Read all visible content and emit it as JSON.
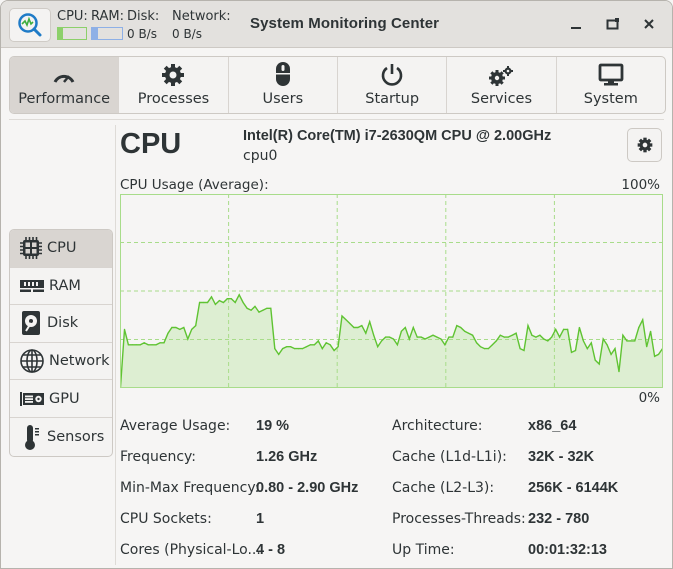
{
  "window": {
    "title": "System Monitoring Center",
    "minimize_icon": "minimize-icon",
    "maximize_icon": "restore-icon",
    "close_icon": "close-icon"
  },
  "header_mini": {
    "cpu_label": "CPU:",
    "ram_label": "RAM:",
    "disk_label": "Disk:",
    "network_label": "Network:",
    "disk_value": "0 B/s",
    "network_value": "0 B/s",
    "cpu_bar_fraction": 0.19,
    "ram_bar_fraction": 0.2,
    "cpu_color": "#8cd06a",
    "ram_color": "#8eb0e6"
  },
  "main_tabs": [
    {
      "label": "Performance",
      "icon": "speedometer-icon",
      "active": true
    },
    {
      "label": "Processes",
      "icon": "gear-icon",
      "active": false
    },
    {
      "label": "Users",
      "icon": "mouse-icon",
      "active": false
    },
    {
      "label": "Startup",
      "icon": "power-icon",
      "active": false
    },
    {
      "label": "Services",
      "icon": "gears-icon",
      "active": false
    },
    {
      "label": "System",
      "icon": "monitor-icon",
      "active": false
    }
  ],
  "side_tabs": [
    {
      "label": "CPU",
      "icon": "cpu-chip-icon",
      "active": true
    },
    {
      "label": "RAM",
      "icon": "ram-icon",
      "active": false
    },
    {
      "label": "Disk",
      "icon": "disk-icon",
      "active": false
    },
    {
      "label": "Network",
      "icon": "globe-icon",
      "active": false
    },
    {
      "label": "GPU",
      "icon": "gpu-icon",
      "active": false
    },
    {
      "label": "Sensors",
      "icon": "thermometer-icon",
      "active": false
    }
  ],
  "cpu": {
    "title": "CPU",
    "model": "Intel(R) Core(TM) i7-2630QM CPU @ 2.00GHz",
    "device": "cpu0",
    "settings_icon": "gear-icon"
  },
  "chart_data": {
    "type": "area",
    "title": "CPU Usage (Average):",
    "max_label": "100%",
    "min_label": "0%",
    "ylim": [
      0,
      100
    ],
    "grid": true,
    "line_color": "#5fc332",
    "fill_color": "#ddeed2",
    "grid_color": "#a8dc8a",
    "values": [
      0,
      30,
      22,
      22,
      22,
      22,
      23,
      22,
      22,
      22,
      23,
      23,
      28,
      31,
      31,
      30,
      31,
      25,
      30,
      32,
      44,
      44,
      44,
      47,
      43,
      45,
      44,
      46,
      46,
      44,
      48,
      44,
      41,
      40,
      42,
      39,
      40,
      41,
      41,
      20,
      17,
      20,
      21,
      21,
      20,
      20,
      20,
      21,
      22,
      22,
      24,
      20,
      23,
      22,
      19,
      21,
      37,
      35,
      33,
      31,
      31,
      32,
      28,
      34,
      27,
      21,
      24,
      26,
      26,
      25,
      22,
      29,
      31,
      25,
      31,
      26,
      26,
      25,
      26,
      27,
      26,
      25,
      22,
      26,
      26,
      32,
      31,
      29,
      28,
      27,
      23,
      21,
      20,
      20,
      22,
      24,
      27,
      26,
      26,
      27,
      28,
      20,
      19,
      32,
      27,
      26,
      27,
      25,
      24,
      26,
      30,
      26,
      30,
      30,
      18,
      19,
      31,
      24,
      20,
      23,
      14,
      12,
      25,
      22,
      17,
      20,
      8,
      27,
      24,
      24,
      24,
      31,
      35,
      21,
      29,
      16,
      17,
      20
    ]
  },
  "info_left": [
    {
      "label": "Average Usage:",
      "value": "19 %"
    },
    {
      "label": "Frequency:",
      "value": "1.26 GHz"
    },
    {
      "label": "Min-Max Frequency:",
      "value": "0.80 - 2.90 GHz"
    },
    {
      "label": "CPU Sockets:",
      "value": "1"
    },
    {
      "label": "Cores (Physical-Lo...",
      "value": "4 - 8"
    }
  ],
  "info_right": [
    {
      "label": "Architecture:",
      "value": "x86_64"
    },
    {
      "label": "Cache (L1d-L1i):",
      "value": "32K - 32K"
    },
    {
      "label": "Cache (L2-L3):",
      "value": "256K - 6144K"
    },
    {
      "label": "Processes-Threads:",
      "value": "232 - 780"
    },
    {
      "label": "Up Time:",
      "value": "00:01:32:13"
    }
  ]
}
